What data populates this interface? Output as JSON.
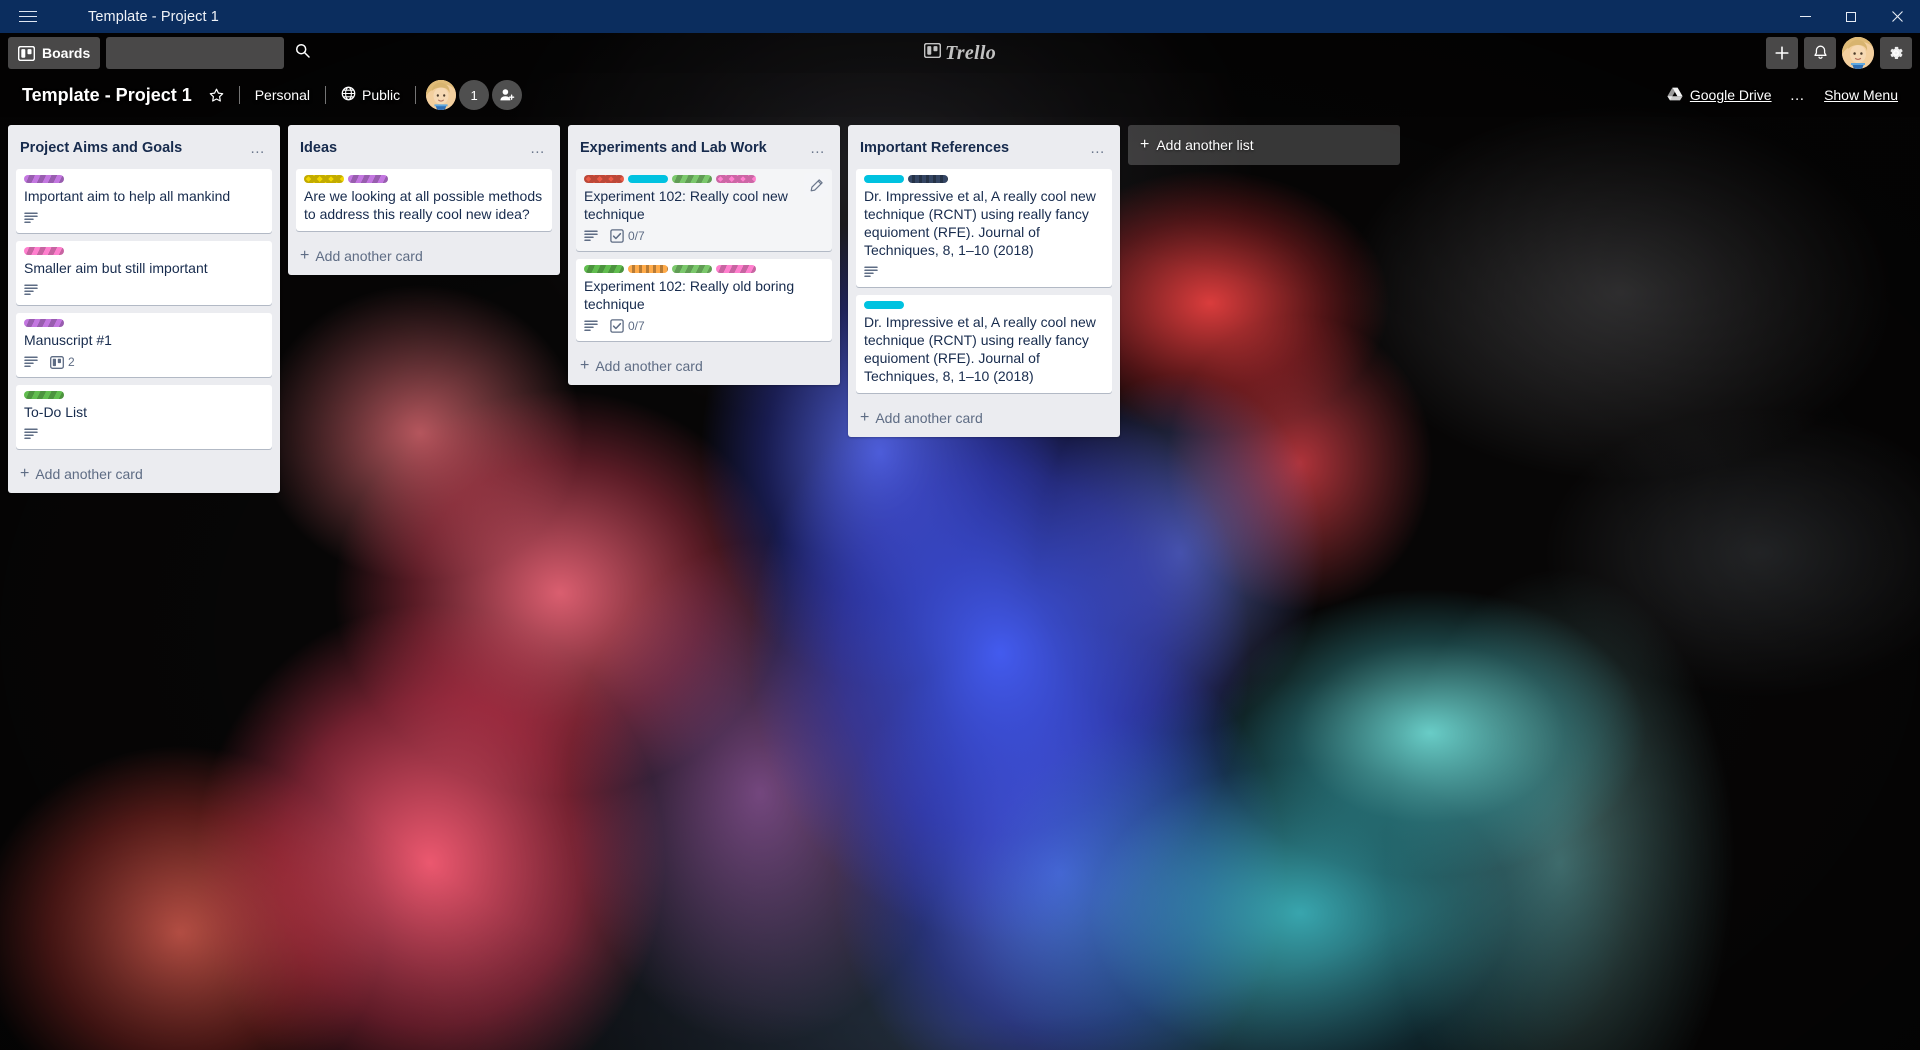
{
  "window": {
    "title": "Template - Project 1",
    "minimize_label": "Minimize",
    "maximize_label": "Maximize",
    "close_label": "Close"
  },
  "topnav": {
    "boards_label": "Boards",
    "search_placeholder": "",
    "search_value": "",
    "logo_text": "Trello",
    "add_label": "+",
    "notifications_label": "Notifications",
    "settings_label": "Settings"
  },
  "board_header": {
    "title": "Template - Project 1",
    "star_label": "Star board",
    "team_label": "Personal",
    "visibility_label": "Public",
    "member_count": "1",
    "add_member_label": "Add member",
    "google_drive_label": "Google Drive",
    "more_label": "…",
    "show_menu_label": "Show Menu"
  },
  "colors": {
    "nav_bg": "#0b2d5e",
    "list_bg": "#ebecf0",
    "card_bg": "#ffffff",
    "text_dark": "#172b4d",
    "text_muted": "#5e6c84",
    "label_purple": "#c377e0",
    "label_pink": "#ff80ce",
    "label_green": "#61bd4f",
    "label_light_green": "#7bc86c",
    "label_yellow": "#f2d600",
    "label_orange": "#ffab4a",
    "label_red": "#eb5a46",
    "label_sky": "#00c2e0",
    "label_black": "#344563"
  },
  "lists": [
    {
      "title": "Project Aims and Goals",
      "menu_label": "…",
      "add_card_label": "Add another card",
      "cards": [
        {
          "title": "Important aim to help all mankind",
          "labels": [
            {
              "color": "#c377e0",
              "pattern": "stripe",
              "name": "purple"
            }
          ],
          "badges": [
            {
              "type": "description",
              "value": ""
            }
          ],
          "hovered": false
        },
        {
          "title": "Smaller aim but still important",
          "labels": [
            {
              "color": "#ff80ce",
              "pattern": "stripe",
              "name": "pink"
            }
          ],
          "badges": [
            {
              "type": "description",
              "value": ""
            }
          ],
          "hovered": false
        },
        {
          "title": "Manuscript #1",
          "labels": [
            {
              "color": "#c377e0",
              "pattern": "stripe",
              "name": "purple"
            }
          ],
          "badges": [
            {
              "type": "description",
              "value": ""
            },
            {
              "type": "board",
              "value": "2"
            }
          ],
          "hovered": false
        },
        {
          "title": "To-Do List",
          "labels": [
            {
              "color": "#61bd4f",
              "pattern": "stripe",
              "name": "green"
            }
          ],
          "badges": [
            {
              "type": "description",
              "value": ""
            }
          ],
          "hovered": false
        }
      ]
    },
    {
      "title": "Ideas",
      "menu_label": "…",
      "add_card_label": "Add another card",
      "cards": [
        {
          "title": "Are we looking at all possible methods to address this really cool new idea?",
          "labels": [
            {
              "color": "#f2d600",
              "pattern": "zigzag",
              "name": "yellow"
            },
            {
              "color": "#c377e0",
              "pattern": "stripe",
              "name": "purple"
            }
          ],
          "badges": [],
          "hovered": false
        }
      ]
    },
    {
      "title": "Experiments and Lab Work",
      "menu_label": "…",
      "add_card_label": "Add another card",
      "cards": [
        {
          "title": "Experiment 102: Really cool new technique",
          "labels": [
            {
              "color": "#eb5a46",
              "pattern": "zigzag",
              "name": "red"
            },
            {
              "color": "#00c2e0",
              "pattern": "solid",
              "name": "sky"
            },
            {
              "color": "#7bc86c",
              "pattern": "stripe",
              "name": "light-green"
            },
            {
              "color": "#ff80ce",
              "pattern": "zigzag",
              "name": "pink"
            }
          ],
          "badges": [
            {
              "type": "description",
              "value": ""
            },
            {
              "type": "checklist",
              "value": "0/7"
            }
          ],
          "hovered": true
        },
        {
          "title": "Experiment 102: Really old boring technique",
          "labels": [
            {
              "color": "#61bd4f",
              "pattern": "stripe",
              "name": "green"
            },
            {
              "color": "#ffab4a",
              "pattern": "bars",
              "name": "orange"
            },
            {
              "color": "#7bc86c",
              "pattern": "stripe",
              "name": "light-green"
            },
            {
              "color": "#ff80ce",
              "pattern": "stripe",
              "name": "pink"
            }
          ],
          "badges": [
            {
              "type": "description",
              "value": ""
            },
            {
              "type": "checklist",
              "value": "0/7"
            }
          ],
          "hovered": false
        }
      ]
    },
    {
      "title": "Important References",
      "menu_label": "…",
      "add_card_label": "Add another card",
      "cards": [
        {
          "title": "Dr. Impressive et al, A really cool new technique (RCNT) using really fancy equioment (RFE). Journal of Techniques, 8, 1–10 (2018)",
          "labels": [
            {
              "color": "#00c2e0",
              "pattern": "solid",
              "name": "sky"
            },
            {
              "color": "#344563",
              "pattern": "bars",
              "name": "black"
            }
          ],
          "badges": [
            {
              "type": "description",
              "value": ""
            }
          ],
          "hovered": false
        },
        {
          "title": "Dr. Impressive et al, A really cool new technique (RCNT) using really fancy equioment (RFE). Journal of Techniques, 8, 1–10 (2018)",
          "labels": [
            {
              "color": "#00c2e0",
              "pattern": "solid",
              "name": "sky"
            }
          ],
          "badges": [],
          "hovered": false
        }
      ]
    }
  ],
  "add_list_label": "Add another list"
}
